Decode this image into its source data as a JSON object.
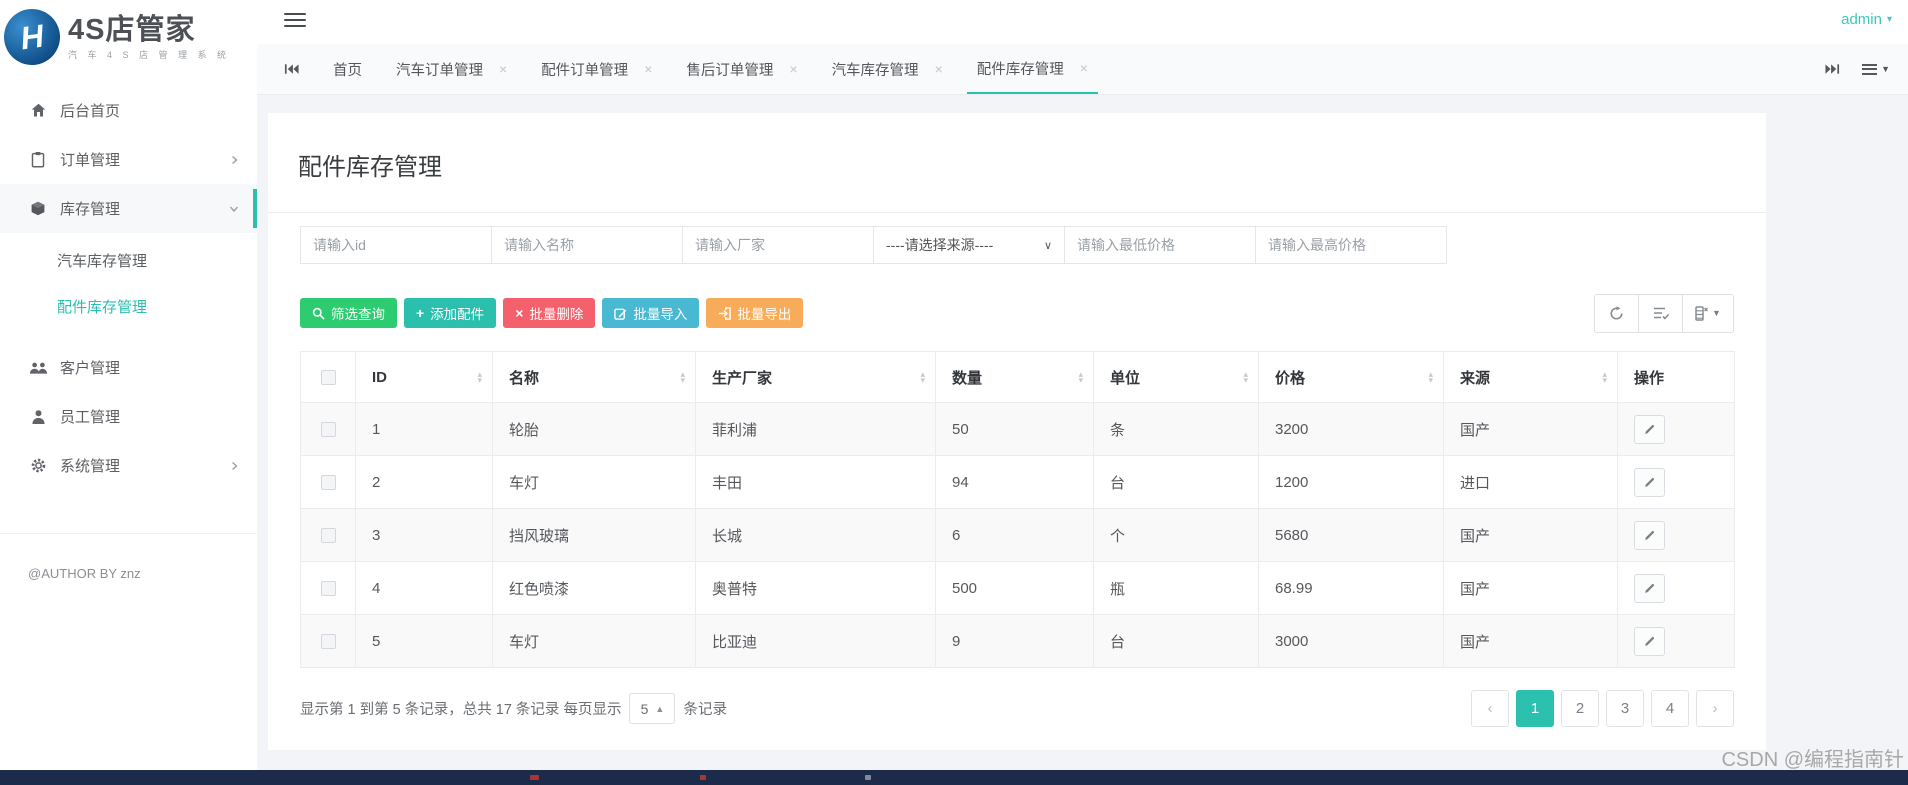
{
  "brand": {
    "logo_letter": "H",
    "name": "4S店管家",
    "subtitle": "汽 车 4 S 店 管 理 系 统"
  },
  "header": {
    "user": "admin"
  },
  "sidebar": {
    "items": [
      {
        "label": "后台首页",
        "icon": "home"
      },
      {
        "label": "订单管理",
        "icon": "clipboard"
      },
      {
        "label": "库存管理",
        "icon": "cube"
      },
      {
        "label": "客户管理",
        "icon": "users"
      },
      {
        "label": "员工管理",
        "icon": "user"
      },
      {
        "label": "系统管理",
        "icon": "gear"
      }
    ],
    "submenu": [
      {
        "label": "汽车库存管理"
      },
      {
        "label": "配件库存管理"
      }
    ],
    "footer": "@AUTHOR BY znz"
  },
  "tabs": {
    "items": [
      {
        "label": "首页"
      },
      {
        "label": "汽车订单管理"
      },
      {
        "label": "配件订单管理"
      },
      {
        "label": "售后订单管理"
      },
      {
        "label": "汽车库存管理"
      },
      {
        "label": "配件库存管理"
      }
    ],
    "active": "配件库存管理"
  },
  "page": {
    "title": "配件库存管理"
  },
  "filters": {
    "id": "请输入id",
    "name": "请输入名称",
    "factory": "请输入厂家",
    "source": "----请选择来源----",
    "min_price": "请输入最低价格",
    "max_price": "请输入最高价格"
  },
  "actions": {
    "query": "筛选查询",
    "add": "添加配件",
    "batch_delete": "批量删除",
    "batch_import": "批量导入",
    "batch_export": "批量导出"
  },
  "table": {
    "columns": [
      "ID",
      "名称",
      "生产厂家",
      "数量",
      "单位",
      "价格",
      "来源",
      "操作"
    ],
    "rows": [
      [
        "1",
        "轮胎",
        "菲利浦",
        "50",
        "条",
        "3200",
        "国产"
      ],
      [
        "2",
        "车灯",
        "丰田",
        "94",
        "台",
        "1200",
        "进口"
      ],
      [
        "3",
        "挡风玻璃",
        "长城",
        "6",
        "个",
        "5680",
        "国产"
      ],
      [
        "4",
        "红色喷漆",
        "奥普特",
        "500",
        "瓶",
        "68.99",
        "国产"
      ],
      [
        "5",
        "车灯",
        "比亚迪",
        "9",
        "台",
        "3000",
        "国产"
      ]
    ]
  },
  "pagination": {
    "info_prefix": "显示第 1 到第 5 条记录，总共 17 条记录 每页显示",
    "page_size": "5",
    "info_suffix": "条记录",
    "pages": [
      "1",
      "2",
      "3",
      "4"
    ],
    "active_page": "1"
  },
  "watermark": "CSDN @编程指南针",
  "colors": {
    "accent": "#2bbfae",
    "green": "#2ecc71",
    "red": "#f4606b",
    "blue": "#49b8d2",
    "orange": "#f8ac59",
    "bottom_strip": "#1d2b4a"
  }
}
